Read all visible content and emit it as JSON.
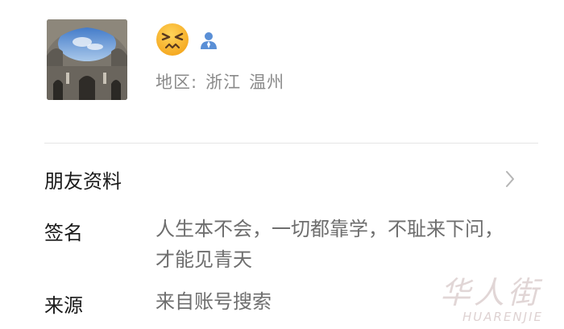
{
  "profile": {
    "nickname_emoji": "😣",
    "region_label": "地区:",
    "province": "浙江",
    "city": "温州"
  },
  "rows": {
    "friend_info_label": "朋友资料",
    "signature_label": "签名",
    "signature_value": "人生本不会，一切都靠学，不耻来下问，才能见青天",
    "source_label": "来源",
    "source_value": "来自账号搜索"
  },
  "watermark": {
    "cn": "华人街",
    "en": "HUARENJIE"
  },
  "icons": {
    "person": "person-icon",
    "chevron": "chevron-right-icon"
  },
  "colors": {
    "person_icon": "#5a8fd6",
    "secondary_text": "#8a8a8a"
  }
}
